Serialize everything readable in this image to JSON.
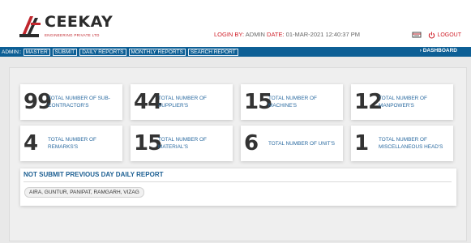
{
  "brand": {
    "name": "CEEKAY",
    "tagline": "ENGINEERING PRIVATE LTD"
  },
  "header": {
    "login_by_label": "LOGIN BY:",
    "login_user": "ADMIN",
    "date_label": "DATE:",
    "date_value": "01-MAR-2021 12:40:37 PM",
    "logout_label": "LOGOUT"
  },
  "nav": {
    "prefix": "ADMIN::",
    "items": [
      "MASTER",
      "SUBMIT",
      "DAILY REPORTS",
      "MONTHLY REPORTS",
      "SEARCH REPORT"
    ],
    "dashboard": "› DASHBOARD"
  },
  "stats": [
    {
      "value": "99",
      "label": "TOTAL NUMBER OF SUB-CONTRACTOR'S"
    },
    {
      "value": "44",
      "label": "TOTAL NUMBER OF SUPPLIER'S"
    },
    {
      "value": "15",
      "label": "TOTAL NUMBER OF MACHINE'S"
    },
    {
      "value": "12",
      "label": "TOTAL NUMBER OF MANPOWER'S"
    },
    {
      "value": "4",
      "label": "TOTAL NUMBER OF REMARKS'S"
    },
    {
      "value": "15",
      "label": "TOTAL NUMBER OF MATERIAL'S"
    },
    {
      "value": "6",
      "label": "TOTAL NUMBER OF UNIT'S"
    },
    {
      "value": "1",
      "label": "TOTAL NUMBER OF MISCELLANEOUS HEAD'S"
    }
  ],
  "not_submitted": {
    "title": "NOT SUBMIT PREVIOUS DAY DAILY REPORT",
    "sites": "AIRA, GUNTUR, PANIPAT, RAMGARH, VIZAG"
  },
  "colors": {
    "nav_bg": "#0d5f95",
    "accent_red": "#d0202a",
    "label_blue": "#2a6aa0"
  }
}
